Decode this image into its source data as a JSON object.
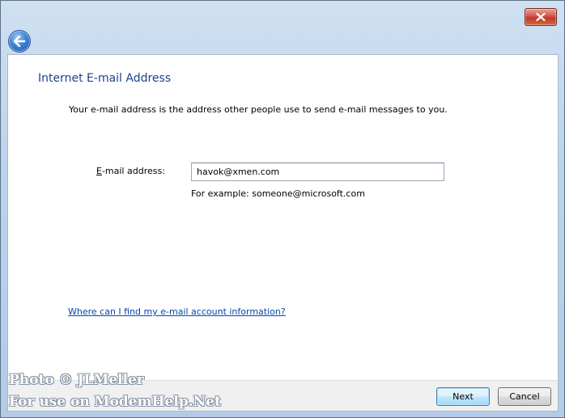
{
  "window": {
    "close_icon": "close-icon",
    "back_icon": "back-arrow-icon"
  },
  "page": {
    "title": "Internet E-mail Address",
    "intro": "Your e-mail address is the address other people use to send e-mail messages to you."
  },
  "form": {
    "email_label_accel": "E",
    "email_label_rest": "-mail address:",
    "email_value": "havok@xmen.com",
    "example": "For example: someone@microsoft.com"
  },
  "help_link": "Where can I find my e-mail account information?",
  "buttons": {
    "next": "Next",
    "cancel": "Cancel"
  },
  "watermark": {
    "line1": "Photo © JLMeller",
    "line2": "For use on ModemHelp.Net"
  },
  "colors": {
    "title": "#1e3f8c",
    "link": "#0645ad",
    "close": "#c0392b"
  }
}
